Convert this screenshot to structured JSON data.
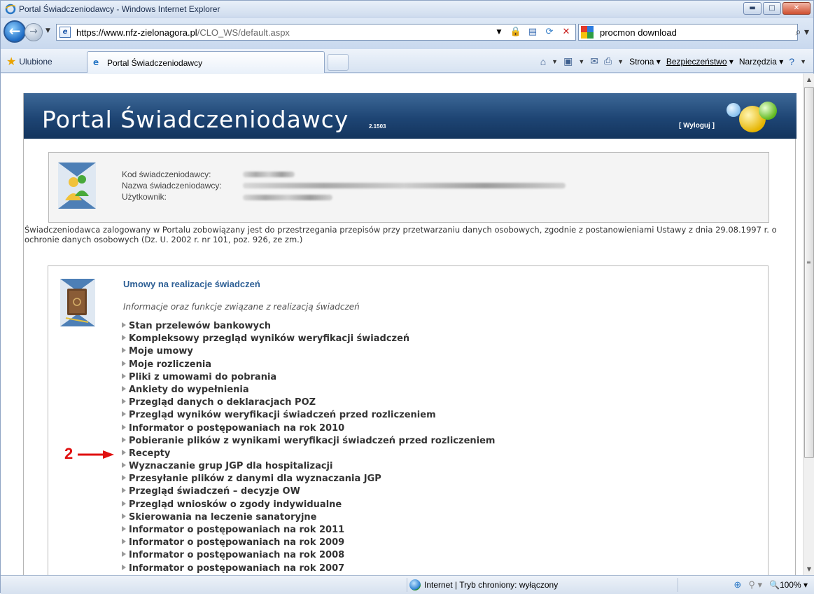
{
  "window": {
    "title": "Portal Świadczeniodawcy - Windows Internet Explorer"
  },
  "address": {
    "url_host": "https://www.nfz-zielonagora.pl",
    "url_path": "/CLO_WS/default.aspx",
    "search_text": "procmon download"
  },
  "tabbar": {
    "favorites_label": "Ulubione",
    "tab_label": "Portal Świadczeniodawcy",
    "cmd_page": "Strona",
    "cmd_security": "Bezpieczeństwo",
    "cmd_tools": "Narzędzia"
  },
  "header": {
    "title": "Portal Świadczeniodawcy",
    "version": "2.1503",
    "logout": "[ Wyloguj ]"
  },
  "info": {
    "label_code": "Kod świadczeniodawcy:",
    "label_name": "Nazwa świadczeniodawcy:",
    "label_user": "Użytkownik:"
  },
  "notice": "Świadczeniodawca zalogowany w Portalu zobowiązany jest do przestrzegania przepisów przy przetwarzaniu danych osobowych, zgodnie z postanowieniami Ustawy z dnia 29.08.1997 r. o ochronie danych osobowych (Dz. U. 2002 r. nr 101, poz. 926, ze zm.)",
  "section": {
    "title": "Umowy na realizacje świadczeń",
    "subtitle": "Informacje oraz funkcje związane z realizacją świadczeń",
    "items": [
      "Stan przelewów bankowych",
      "Kompleksowy przegląd wyników weryfikacji świadczeń",
      "Moje umowy",
      "Moje rozliczenia",
      "Pliki z umowami do pobrania",
      "Ankiety do wypełnienia",
      "Przegląd danych o deklaracjach POZ",
      "Przegląd wyników weryfikacji świadczeń przed rozliczeniem",
      "Informator o postępowaniach na rok 2010",
      "Pobieranie plików z wynikami weryfikacji świadczeń przed rozliczeniem",
      "Recepty",
      "Wyznaczanie grup JGP dla hospitalizacji",
      "Przesyłanie plików z danymi dla wyznaczania JGP",
      "Przegląd świadczeń – decyzje OW",
      "Przegląd wniosków o zgody indywidualne",
      "Skierowania na leczenie sanatoryjne",
      "Informator o postępowaniach na rok 2011",
      "Informator o postępowaniach na rok 2009",
      "Informator o postępowaniach na rok 2008",
      "Informator o postępowaniach na rok 2007"
    ]
  },
  "annotation": {
    "number": "2"
  },
  "status": {
    "zone": "Internet | Tryb chroniony: wyłączony",
    "zoom": "100%"
  },
  "colors": {
    "header_bg": "#1e4574",
    "section_title": "#2d5f95",
    "annotation": "#e01010"
  }
}
